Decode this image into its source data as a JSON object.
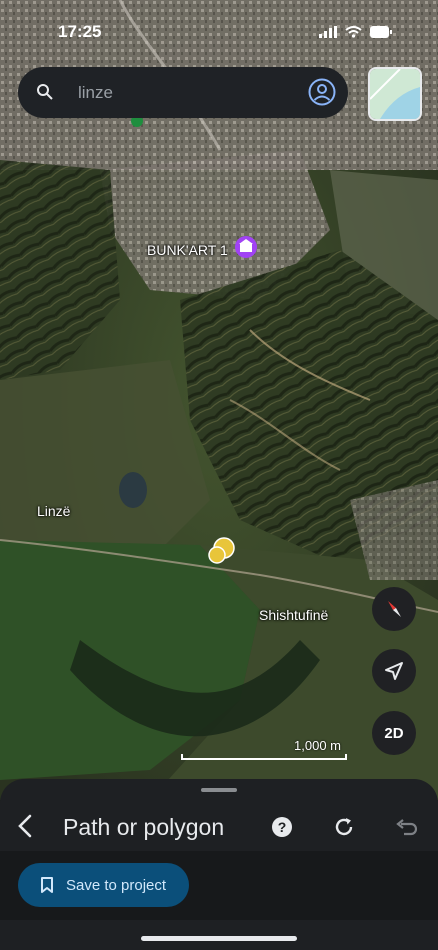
{
  "status_bar": {
    "time": "17:25"
  },
  "search": {
    "placeholder": "linze"
  },
  "map": {
    "labels": [
      {
        "text": "BUNK'ART 1",
        "icon": "museum-pin-icon"
      },
      {
        "text": "Linzë"
      },
      {
        "text": "Shishtufinë"
      }
    ],
    "scale": "1,000 m",
    "view_mode": "2D"
  },
  "sheet": {
    "title": "Path or polygon",
    "save_label": "Save to project"
  },
  "colors": {
    "accent_button": "#0b4f7a",
    "sheet_bg": "#1e2023"
  }
}
